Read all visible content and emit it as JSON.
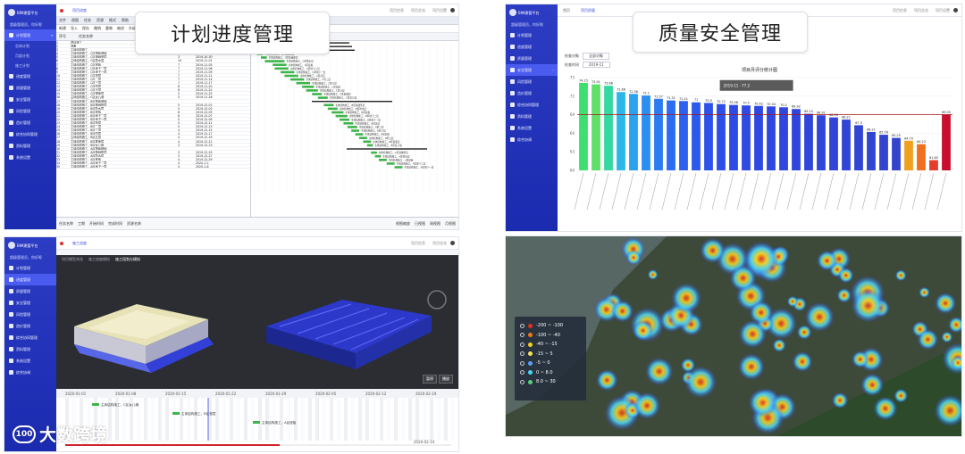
{
  "callouts": {
    "schedule": "计划进度管理",
    "quality": "质量安全管理"
  },
  "brand": {
    "title": "BIM建管平台",
    "subtitle": "智慧建造管理平台",
    "user": "超级管理员，你好呢",
    "accent": "#2536bb",
    "active": "#4a5cf0"
  },
  "sidebar": {
    "items": [
      {
        "label": "计划管理",
        "icon": "calendar-icon"
      },
      {
        "label": "进度管理",
        "icon": "progress-icon"
      },
      {
        "label": "质量管理",
        "icon": "check-icon"
      },
      {
        "label": "安全管理",
        "icon": "shield-icon"
      },
      {
        "label": "风险管理",
        "icon": "warning-icon"
      },
      {
        "label": "造价管理",
        "icon": "money-icon"
      },
      {
        "label": "综合协同管理",
        "icon": "users-icon"
      },
      {
        "label": "资料管理",
        "icon": "folder-icon"
      },
      {
        "label": "系统设置",
        "icon": "gear-icon"
      },
      {
        "label": "综合协调",
        "icon": "link-icon"
      }
    ],
    "sub_items_schedule": [
      "总体计划",
      "月度计划",
      "施工计划"
    ]
  },
  "topbar": {
    "schedule_tab": "项目进度",
    "quality_tabs": [
      "首页",
      "项目质量",
      "项目安全"
    ],
    "bim_tab": "施工进度",
    "right": [
      "项目信息",
      "项目总览",
      "项目设置"
    ]
  },
  "gantt": {
    "menu": [
      "文件",
      "视图",
      "任务",
      "资源",
      "格式",
      "帮助"
    ],
    "toolbar": [
      "新建",
      "导入",
      "保存",
      "撤销",
      "重做",
      "缩进",
      "升级",
      "降级",
      "链接",
      "拆分"
    ],
    "columns": [
      "序号",
      "任务名称",
      "工期",
      "开始时间"
    ],
    "rows": [
      {
        "id": "1",
        "name": "项目施工",
        "dur": "",
        "start": ""
      },
      {
        "id": "2",
        "name": "准备",
        "dur": "",
        "start": ""
      },
      {
        "id": "3",
        "name": "主体结构施工",
        "dur": "",
        "start": ""
      },
      {
        "id": "4",
        "name": "主体结构施工，C区筏板基础",
        "dur": "3",
        "start": "2019-10-28"
      },
      {
        "id": "5",
        "name": "主体结构施工，C区基础垫层",
        "dur": "3",
        "start": "2019-10-30"
      },
      {
        "id": "6",
        "name": "主体结构施工，C区防水层",
        "dur": "10",
        "start": "2019-11-01"
      },
      {
        "id": "7",
        "name": "主体结构施工，C区底板",
        "dur": "7",
        "start": "2019-11-05"
      },
      {
        "id": "8",
        "name": "主体结构施工，C区地下二层",
        "dur": "7",
        "start": "2019-11-06"
      },
      {
        "id": "9",
        "name": "主体结构施工，C区地下一层",
        "dur": "7",
        "start": "2019-11-09"
      },
      {
        "id": "10",
        "name": "主体结构施工，C区首层",
        "dur": "7",
        "start": "2019-11-11"
      },
      {
        "id": "11",
        "name": "主体结构施工，C区二层",
        "dur": "7",
        "start": "2019-11-14"
      },
      {
        "id": "12",
        "name": "主体结构施工，C区三层",
        "dur": "7",
        "start": "2019-11-17"
      },
      {
        "id": "13",
        "name": "主体结构施工，C区四层",
        "dur": "6",
        "start": "2019-11-20"
      },
      {
        "id": "14",
        "name": "主体结构施工，C区五层",
        "dur": "6",
        "start": "2019-11-22"
      },
      {
        "id": "15",
        "name": "主体结构施工，C区屋面层",
        "dur": "5",
        "start": "2019-11-25"
      },
      {
        "id": "16",
        "name": "主体结构施工，C区女儿墙",
        "dur": "5",
        "start": "2019-11-28"
      },
      {
        "id": "17",
        "name": "主体结构施工，B区筏板基础",
        "dur": "",
        "start": ""
      },
      {
        "id": "18",
        "name": "主体结构施工，B区基础垫层",
        "dur": "5",
        "start": "2019-12-01"
      },
      {
        "id": "19",
        "name": "主体结构施工，B区防水层",
        "dur": "5",
        "start": "2019-12-03"
      },
      {
        "id": "20",
        "name": "主体结构施工，B区底板",
        "dur": "6",
        "start": "2019-12-05"
      },
      {
        "id": "21",
        "name": "主体结构施工，B区地下二层",
        "dur": "6",
        "start": "2019-12-07"
      },
      {
        "id": "22",
        "name": "主体结构施工，B区地下一层",
        "dur": "5",
        "start": "2019-12-09"
      },
      {
        "id": "23",
        "name": "主体结构施工，B区首层",
        "dur": "5",
        "start": "2019-12-11"
      },
      {
        "id": "24",
        "name": "主体结构施工，B区二层",
        "dur": "5",
        "start": "2019-12-13"
      },
      {
        "id": "25",
        "name": "主体结构施工，B区三层",
        "dur": "4",
        "start": "2019-12-15"
      },
      {
        "id": "26",
        "name": "主体结构施工，B区四层",
        "dur": "4",
        "start": "2019-12-17"
      },
      {
        "id": "27",
        "name": "主体结构施工，B区五层",
        "dur": "4",
        "start": "2019-12-19"
      },
      {
        "id": "28",
        "name": "主体结构施工，B区屋面层",
        "dur": "4",
        "start": "2019-12-21"
      },
      {
        "id": "29",
        "name": "主体结构施工，B区女儿墙",
        "dur": "3",
        "start": "2019-12-23"
      },
      {
        "id": "30",
        "name": "主体结构施工，A区筏板基础",
        "dur": "",
        "start": ""
      },
      {
        "id": "31",
        "name": "主体结构施工，A区基础垫层",
        "dur": "3",
        "start": "2019-12-25"
      },
      {
        "id": "32",
        "name": "主体结构施工，A区防水层",
        "dur": "3",
        "start": "2019-12-27"
      },
      {
        "id": "33",
        "name": "主体结构施工，A区底板",
        "dur": "4",
        "start": "2019-12-29"
      },
      {
        "id": "34",
        "name": "主体结构施工，A区地下二层",
        "dur": "4",
        "start": "2020-1-2"
      },
      {
        "id": "35",
        "name": "主体结构施工，A区地下一层",
        "dur": "4",
        "start": "2020-1-6"
      }
    ],
    "footer": [
      "任务名称",
      "工期",
      "开始时间",
      "完成时间",
      "资源名称"
    ],
    "footer_right": [
      "视图缩放",
      "日视图",
      "周视图",
      "月视图"
    ]
  },
  "quality": {
    "filter1_label": "检查对象",
    "filter1_value": "全部对象",
    "filter2_label": "检查时间",
    "filter2_value": "2019-11",
    "tooltip": "2019-11 · 77.2",
    "right_icons": [
      "download-icon",
      "refresh-icon",
      "fullscreen-icon"
    ]
  },
  "chart_data": {
    "type": "bar",
    "title": "项目月评分统计图",
    "ylim": [
      60,
      75
    ],
    "yticks": [
      60,
      63,
      66,
      69,
      72,
      75
    ],
    "reference_line": 69,
    "values": [
      74.15,
      73.91,
      73.68,
      72.66,
      72.36,
      72.1,
      71.57,
      71.31,
      71.21,
      71.0,
      70.9,
      70.72,
      70.58,
      70.5,
      70.42,
      70.34,
      70.2,
      69.92,
      69.15,
      68.91,
      68.56,
      68.21,
      67.3,
      66.21,
      65.76,
      65.25,
      64.79,
      64.23,
      61.65,
      69.05
    ],
    "colors": [
      "#3de070",
      "#5ee06a",
      "#35d8a0",
      "#2bb8e8",
      "#2aa3ee",
      "#2b8ff0",
      "#2c7cf0",
      "#2c6cf0",
      "#2d60ee",
      "#2d58ec",
      "#2d52ea",
      "#2e4ee8",
      "#2e4be6",
      "#2f49e4",
      "#2f48e2",
      "#2f47e0",
      "#3046de",
      "#3045dc",
      "#3145da",
      "#3145d8",
      "#3145d6",
      "#3145d4",
      "#3245d2",
      "#3245d0",
      "#3345ce",
      "#3445cc",
      "#f0a020",
      "#f07020",
      "#e53d2c",
      "#c8102e"
    ]
  },
  "bim": {
    "crumbs": [
      "项目模型浏览",
      "施工进度模拟",
      "施工段划分模拟"
    ],
    "buttons": [
      "暂停",
      "播放"
    ],
    "timeline_dates": [
      "2020-01-01",
      "2020-01-08",
      "2020-01-15",
      "2020-01-22",
      "2020-01-29",
      "2020-02-05",
      "2020-02-12",
      "2020-02-19"
    ],
    "task_labels": [
      "主体结构施工，C区女儿墙",
      "主体结构施工，B区首层",
      "主体结构施工，A区底板"
    ],
    "current_date": "2020-02-14"
  },
  "heatmap": {
    "legend": [
      {
        "range": "-200 ~ -100",
        "color": "#e0301e"
      },
      {
        "range": "-100 ~ -40",
        "color": "#f07a1a"
      },
      {
        "range": "-40 ~ -15",
        "color": "#f5d020"
      },
      {
        "range": "-15 ~ 5",
        "color": "#f8e35a"
      },
      {
        "range": "-5 ~ 0",
        "color": "#5aa0f5"
      },
      {
        "range": "0 ~ 8.0",
        "color": "#4ad3f0"
      },
      {
        "range": "8.0 ~ 30",
        "color": "#53d27a"
      }
    ]
  },
  "watermark": {
    "logo": "100",
    "text": "大数跨境"
  }
}
